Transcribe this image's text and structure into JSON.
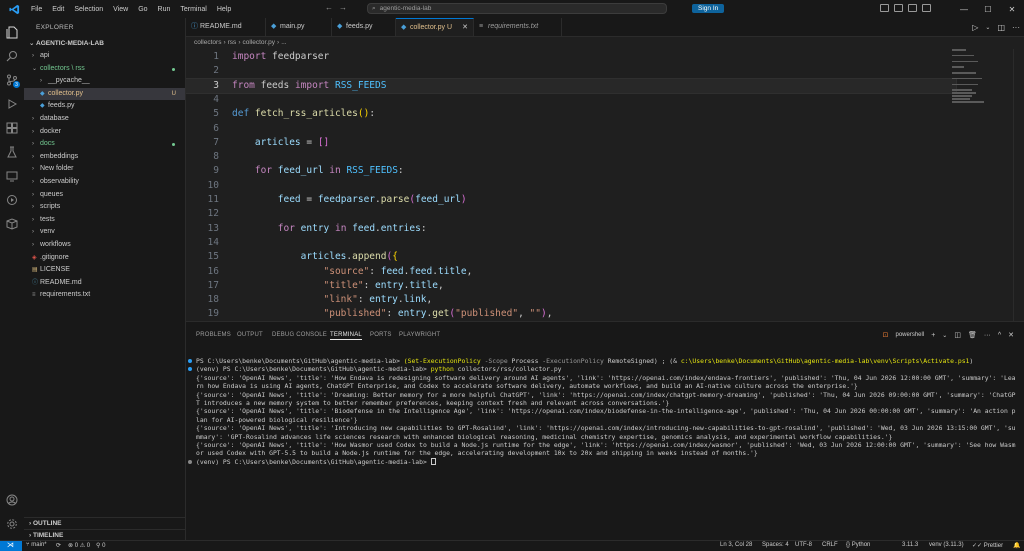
{
  "window": {
    "menu": [
      "File",
      "Edit",
      "Selection",
      "View",
      "Go",
      "Run",
      "Terminal",
      "Help"
    ],
    "search_text": "agentic-media-lab",
    "sign_in": "Sign In",
    "colors": {
      "accent": "#0078d4",
      "background": "#1f1f1f",
      "sidebar": "#181818"
    }
  },
  "explorer": {
    "title": "EXPLORER",
    "root": "AGENTIC-MEDIA-LAB",
    "items": [
      {
        "label": "api",
        "type": "folder",
        "expanded": false,
        "depth": 0
      },
      {
        "label": "collectors \\ rss",
        "type": "folder",
        "expanded": true,
        "depth": 0,
        "color": "#73c991"
      },
      {
        "label": "__pycache__",
        "type": "folder",
        "expanded": false,
        "depth": 1
      },
      {
        "label": "collector.py",
        "type": "python",
        "depth": 1,
        "selected": true,
        "color": "#e2c08d",
        "mark": "U"
      },
      {
        "label": "feeds.py",
        "type": "python",
        "depth": 1
      },
      {
        "label": "database",
        "type": "folder",
        "expanded": false,
        "depth": 0
      },
      {
        "label": "docker",
        "type": "folder",
        "expanded": false,
        "depth": 0
      },
      {
        "label": "docs",
        "type": "folder",
        "expanded": false,
        "depth": 0,
        "color": "#73c991"
      },
      {
        "label": "embeddings",
        "type": "folder",
        "expanded": false,
        "depth": 0
      },
      {
        "label": "New folder",
        "type": "folder",
        "expanded": false,
        "depth": 0
      },
      {
        "label": "observability",
        "type": "folder",
        "expanded": false,
        "depth": 0
      },
      {
        "label": "queues",
        "type": "folder",
        "expanded": false,
        "depth": 0
      },
      {
        "label": "scripts",
        "type": "folder",
        "expanded": false,
        "depth": 0
      },
      {
        "label": "tests",
        "type": "folder",
        "expanded": false,
        "depth": 0
      },
      {
        "label": "venv",
        "type": "folder",
        "expanded": false,
        "depth": 0
      },
      {
        "label": "workflows",
        "type": "folder",
        "expanded": false,
        "depth": 0
      },
      {
        "label": ".gitignore",
        "type": "git",
        "depth": 0
      },
      {
        "label": "LICENSE",
        "type": "license",
        "depth": 0
      },
      {
        "label": "README.md",
        "type": "info",
        "depth": 0
      },
      {
        "label": "requirements.txt",
        "type": "text",
        "depth": 0
      }
    ],
    "outline": "OUTLINE",
    "timeline": "TIMELINE"
  },
  "tabs": [
    {
      "label": "README.md",
      "icon": "info-icon",
      "color": "#519aba"
    },
    {
      "label": "main.py",
      "icon": "python-icon",
      "color": "#519aba"
    },
    {
      "label": "feeds.py",
      "icon": "python-icon",
      "color": "#519aba"
    },
    {
      "label": "collector.py U",
      "icon": "python-icon",
      "color": "#e2c08d",
      "active": true
    },
    {
      "label": "requirements.txt",
      "icon": "text-icon",
      "color": "#9d9d9d"
    }
  ],
  "breadcrumb": [
    "collectors",
    "rss",
    "collector.py",
    "..."
  ],
  "editor": {
    "current_line": 3,
    "lines": [
      [
        [
          "kw",
          "import"
        ],
        [
          "pun",
          " feedparser"
        ]
      ],
      [],
      [
        [
          "kw",
          "from"
        ],
        [
          "pun",
          " feeds "
        ],
        [
          "kw",
          "import"
        ],
        [
          "const",
          " RSS_FEEDS"
        ]
      ],
      [],
      [
        [
          "def",
          "def"
        ],
        [
          "fn",
          " fetch_rss_articles"
        ],
        [
          "br",
          "("
        ],
        [
          "br",
          ")"
        ],
        [
          "pun",
          ":"
        ]
      ],
      [],
      [
        [
          "pun",
          "    "
        ],
        [
          "var",
          "articles"
        ],
        [
          "pun",
          " = "
        ],
        [
          "br2",
          "[]"
        ]
      ],
      [],
      [
        [
          "pun",
          "    "
        ],
        [
          "kw",
          "for"
        ],
        [
          "var",
          " feed_url"
        ],
        [
          "kw",
          " in"
        ],
        [
          "const",
          " RSS_FEEDS"
        ],
        [
          "pun",
          ":"
        ]
      ],
      [],
      [
        [
          "pun",
          "        "
        ],
        [
          "var",
          "feed"
        ],
        [
          "pun",
          " = "
        ],
        [
          "var",
          "feedparser"
        ],
        [
          "pun",
          "."
        ],
        [
          "fn",
          "parse"
        ],
        [
          "br2",
          "("
        ],
        [
          "var",
          "feed_url"
        ],
        [
          "br2",
          ")"
        ]
      ],
      [],
      [
        [
          "pun",
          "        "
        ],
        [
          "kw",
          "for"
        ],
        [
          "var",
          " entry"
        ],
        [
          "kw",
          " in"
        ],
        [
          "var",
          " feed"
        ],
        [
          "pun",
          "."
        ],
        [
          "var",
          "entries"
        ],
        [
          "pun",
          ":"
        ]
      ],
      [],
      [
        [
          "pun",
          "            "
        ],
        [
          "var",
          "articles"
        ],
        [
          "pun",
          "."
        ],
        [
          "fn",
          "append"
        ],
        [
          "br2",
          "("
        ],
        [
          "br",
          "{"
        ]
      ],
      [
        [
          "pun",
          "                "
        ],
        [
          "str",
          "\"source\""
        ],
        [
          "pun",
          ": "
        ],
        [
          "var",
          "feed"
        ],
        [
          "pun",
          "."
        ],
        [
          "var",
          "feed"
        ],
        [
          "pun",
          "."
        ],
        [
          "var",
          "title"
        ],
        [
          "pun",
          ","
        ]
      ],
      [
        [
          "pun",
          "                "
        ],
        [
          "str",
          "\"title\""
        ],
        [
          "pun",
          ": "
        ],
        [
          "var",
          "entry"
        ],
        [
          "pun",
          "."
        ],
        [
          "var",
          "title"
        ],
        [
          "pun",
          ","
        ]
      ],
      [
        [
          "pun",
          "                "
        ],
        [
          "str",
          "\"link\""
        ],
        [
          "pun",
          ": "
        ],
        [
          "var",
          "entry"
        ],
        [
          "pun",
          "."
        ],
        [
          "var",
          "link"
        ],
        [
          "pun",
          ","
        ]
      ],
      [
        [
          "pun",
          "                "
        ],
        [
          "str",
          "\"published\""
        ],
        [
          "pun",
          ": "
        ],
        [
          "var",
          "entry"
        ],
        [
          "pun",
          "."
        ],
        [
          "fn",
          "get"
        ],
        [
          "br2",
          "("
        ],
        [
          "str",
          "\"published\""
        ],
        [
          "pun",
          ", "
        ],
        [
          "str",
          "\"\""
        ],
        [
          "br2",
          ")"
        ],
        [
          "pun",
          ","
        ]
      ]
    ]
  },
  "panel": {
    "tabs": [
      "PROBLEMS",
      "OUTPUT",
      "DEBUG CONSOLE",
      "TERMINAL",
      "PORTS",
      "PLAYWRIGHT"
    ],
    "active_tab": "TERMINAL",
    "shell": "powershell",
    "terminal": [
      {
        "segments": [
          [
            "g",
            "PS C:\\Users\\benke\\Documents\\GitHub\\agentic-media-lab> "
          ],
          [
            "y",
            "(Set-ExecutionPolicy "
          ],
          [
            "f",
            "-Scope "
          ],
          [
            "g",
            "Process "
          ],
          [
            "f",
            "-ExecutionPolicy "
          ],
          [
            "g",
            "RemoteSigned) ; (& "
          ],
          [
            "y",
            "c:\\Users\\benke\\Documents\\GitHub\\agentic-media-lab\\venv\\Scripts\\Activate.ps1"
          ],
          [
            "g",
            ")"
          ]
        ],
        "marker": "#2a9df4"
      },
      {
        "segments": [
          [
            "g",
            "(venv) PS C:\\Users\\benke\\Documents\\GitHub\\agentic-media-lab> "
          ],
          [
            "y",
            "python "
          ],
          [
            "g",
            "collectors/rss/collector.py"
          ]
        ],
        "marker": "#2a9df4"
      },
      {
        "segments": [
          [
            "g",
            "{'source': 'OpenAI News', 'title': 'How Endava is redesigning software delivery around AI agents', 'link': 'https://openai.com/index/endava-frontiers', 'published': 'Thu, 04 Jun 2026 12:00:00 GMT', 'summary': 'Learn how Endava is using AI agents, ChatGPT Enterprise, and Codex to accelerate software delivery, automate workflows, and build an AI-native culture across the enterprise.'}"
          ]
        ]
      },
      {
        "segments": [
          [
            "g",
            "{'source': 'OpenAI News', 'title': 'Dreaming: Better memory for a more helpful ChatGPT', 'link': 'https://openai.com/index/chatgpt-memory-dreaming', 'published': 'Thu, 04 Jun 2026 09:00:00 GMT', 'summary': 'ChatGPT introduces a new memory system to better remember preferences, keeping context fresh and relevant across conversations.'}"
          ]
        ]
      },
      {
        "segments": [
          [
            "g",
            "{'source': 'OpenAI News', 'title': 'Biodefense in the Intelligence Age', 'link': 'https://openai.com/index/biodefense-in-the-intelligence-age', 'published': 'Thu, 04 Jun 2026 00:00:00 GMT', 'summary': 'An action plan for AI-powered biological resilience'}"
          ]
        ]
      },
      {
        "segments": [
          [
            "g",
            "{'source': 'OpenAI News', 'title': 'Introducing new capabilities to GPT-Rosalind', 'link': 'https://openai.com/index/introducing-new-capabilities-to-gpt-rosalind', 'published': 'Wed, 03 Jun 2026 13:15:00 GMT', 'summary': 'GPT-Rosalind advances life sciences research with enhanced biological reasoning, medicinal chemistry expertise, genomics analysis, and experimental workflow capabilities.'}"
          ]
        ]
      },
      {
        "segments": [
          [
            "g",
            "{'source': 'OpenAI News', 'title': 'How Wasmor used Codex to build a Node.js runtime for the edge', 'link': 'https://openai.com/index/wasmor', 'published': 'Wed, 03 Jun 2026 12:00:00 GMT', 'summary': 'See how Wasmor used Codex with GPT-5.5 to build a Node.js runtime for the edge, accelerating development 10x to 20x and shipping in weeks instead of months.'}"
          ]
        ]
      },
      {
        "segments": [
          [
            "g",
            "(venv) PS C:\\Users\\benke\\Documents\\GitHub\\agentic-media-lab> "
          ]
        ],
        "cursor": true,
        "marker": "#888888"
      }
    ]
  },
  "status": {
    "branch": "main*",
    "errors": "0",
    "warnings": "0",
    "ports": "0",
    "position": "Ln 3, Col 28",
    "spaces": "Spaces: 4",
    "encoding": "UTF-8",
    "eol": "CRLF",
    "language": "Python",
    "py_version": "3.11.3",
    "venv": "venv (3.11.3)",
    "formatter": "Prettier"
  }
}
